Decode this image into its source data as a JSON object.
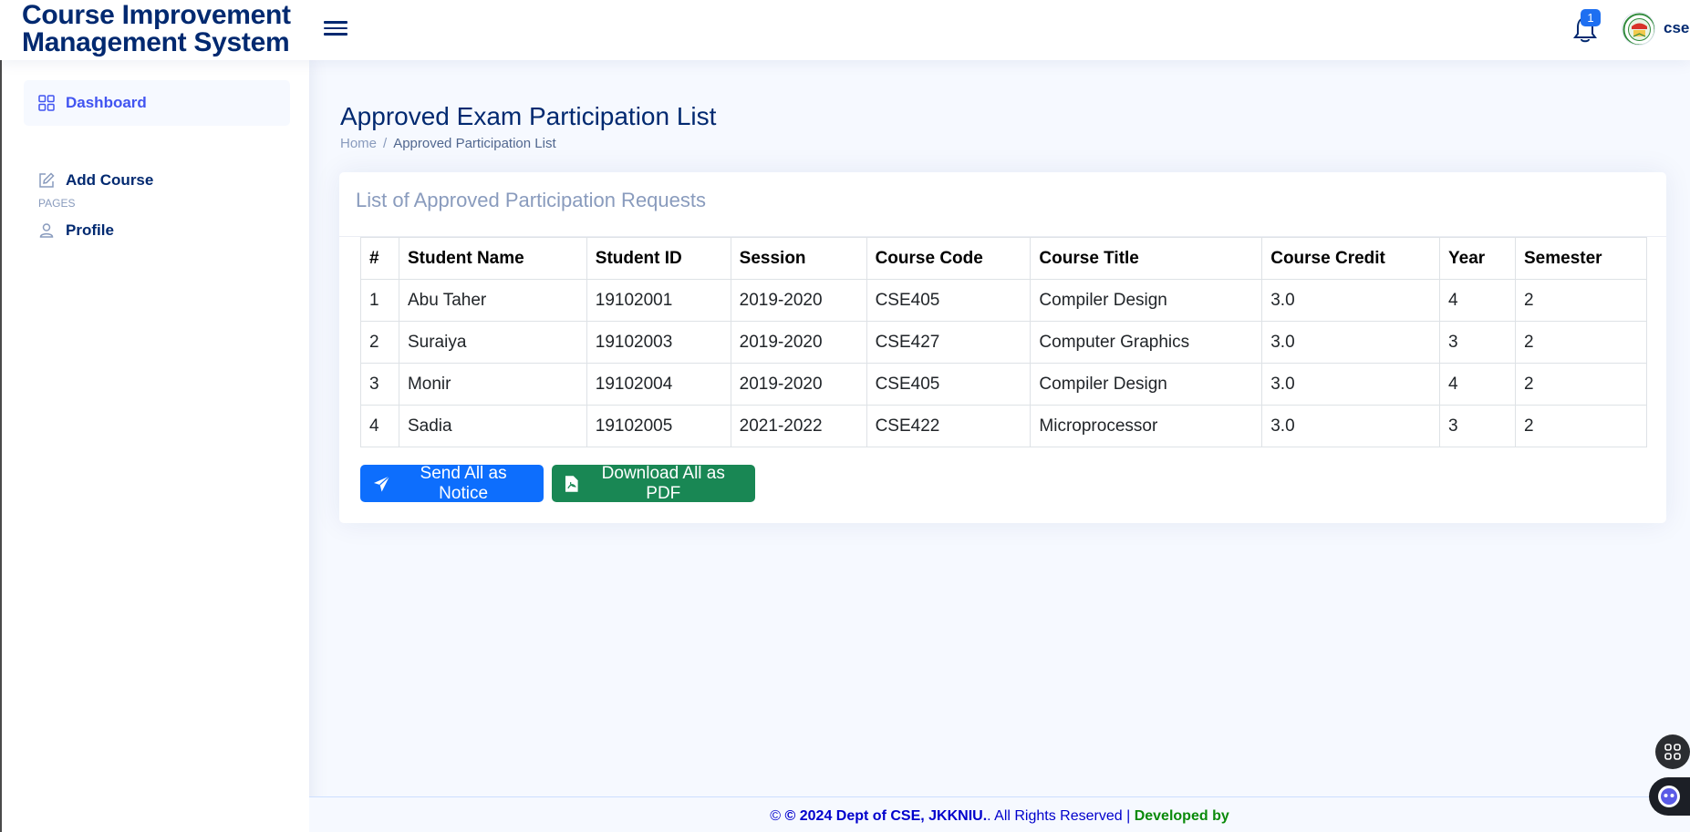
{
  "header": {
    "brand_line1": "Course Improvement",
    "brand_line2": "Management System",
    "notification_count": "1",
    "user_name": "cse"
  },
  "sidebar": {
    "items": [
      {
        "label": "Dashboard",
        "icon": "grid-icon"
      },
      {
        "label": "Add Course",
        "icon": "edit-icon"
      },
      {
        "label": "Profile",
        "icon": "person-icon"
      }
    ],
    "heading": "PAGES"
  },
  "page": {
    "title": "Approved Exam Participation List",
    "breadcrumb_home": "Home",
    "breadcrumb_sep": "/",
    "breadcrumb_current": "Approved Participation List"
  },
  "card": {
    "title": "List of Approved Participation Requests",
    "columns": [
      "#",
      "Student Name",
      "Student ID",
      "Session",
      "Course Code",
      "Course Title",
      "Course Credit",
      "Year",
      "Semester"
    ],
    "rows": [
      [
        "1",
        "Abu Taher",
        "19102001",
        "2019-2020",
        "CSE405",
        "Compiler Design",
        "3.0",
        "4",
        "2"
      ],
      [
        "2",
        "Suraiya",
        "19102003",
        "2019-2020",
        "CSE427",
        "Computer Graphics",
        "3.0",
        "3",
        "2"
      ],
      [
        "3",
        "Monir",
        "19102004",
        "2019-2020",
        "CSE405",
        "Compiler Design",
        "3.0",
        "4",
        "2"
      ],
      [
        "4",
        "Sadia",
        "19102005",
        "2021-2022",
        "CSE422",
        "Microprocessor",
        "3.0",
        "3",
        "2"
      ]
    ],
    "send_button": "Send All as Notice",
    "download_button": "Download All as PDF"
  },
  "footer": {
    "copy_symbol": "©",
    "copy_main": "© 2024 Dept of CSE, JKKNIU.",
    "rights": ". All Rights Reserved |",
    "developed": "Developed by"
  },
  "colors": {
    "primary": "#0d6efd",
    "success": "#198754",
    "navy": "#012970",
    "accent": "#4154f1"
  }
}
